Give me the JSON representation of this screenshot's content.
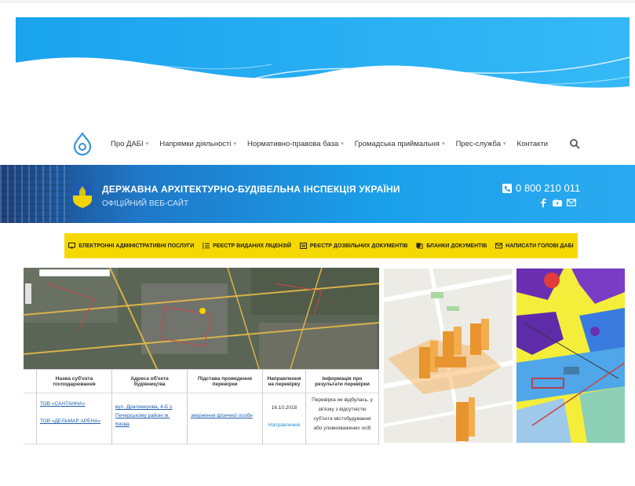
{
  "nav": {
    "items": [
      {
        "label": "Про ДАБІ",
        "dropdown": true
      },
      {
        "label": "Напрямки діяльності",
        "dropdown": true
      },
      {
        "label": "Нормативно-правова база",
        "dropdown": true
      },
      {
        "label": "Громадська приймальня",
        "dropdown": true
      },
      {
        "label": "Прес-служба",
        "dropdown": true
      },
      {
        "label": "Контакти",
        "dropdown": false
      }
    ],
    "search_icon": "search-icon"
  },
  "banner": {
    "title": "ДЕРЖАВНА АРХІТЕКТУРНО-БУДІВЕЛЬНА ІНСПЕКЦІЯ УКРАЇНИ",
    "subtitle": "ОФІЦІЙНИЙ ВЕБ-САЙТ",
    "phone": "0 800 210 011",
    "social": [
      "facebook-icon",
      "youtube-icon",
      "mail-icon"
    ]
  },
  "services": {
    "items": [
      {
        "icon": "monitor-icon",
        "label": "ЕЛЕКТРОННІ АДМІНІСТРАТИВНІ ПОСЛУГИ"
      },
      {
        "icon": "list-icon",
        "label": "РЕЄСТР ВИДАНИХ ЛІЦЕНЗІЙ"
      },
      {
        "icon": "register-icon",
        "label": "РЕЄСТР ДОЗВІЛЬНИХ ДОКУМЕНТІВ"
      },
      {
        "icon": "documents-icon",
        "label": "БЛАНКИ ДОКУМЕНТІВ"
      },
      {
        "icon": "envelope-icon",
        "label": "НАПИСАТИ ГОЛОВІ ДАБІ"
      }
    ]
  },
  "table": {
    "headers": [
      "Назва суб'єкта господарювання",
      "Адреса об'єкта будівництва",
      "Підстава проведення перевірки",
      "Направлення на перевірку",
      "Інформація про результати перевірки"
    ],
    "row": {
      "company1": "ТОВ «САНТАННА»",
      "company2": "ТОВ «ДЕЛЬМАР АРЕНА»",
      "address": "вул. Драгомирова, 4-Б у Печерському районі м. Києва",
      "basis": "звернення фізичної особи",
      "date": "16.10.2018",
      "direction": "Направлення",
      "result": "Перевірка не відбулась, у зв'язку з відсутністю суб'єкта містобудування або уповноважених осіб"
    }
  },
  "colors": {
    "accent_blue": "#1aa0ea",
    "yellow_bar": "#f5d800",
    "link": "#1f5fb0"
  }
}
